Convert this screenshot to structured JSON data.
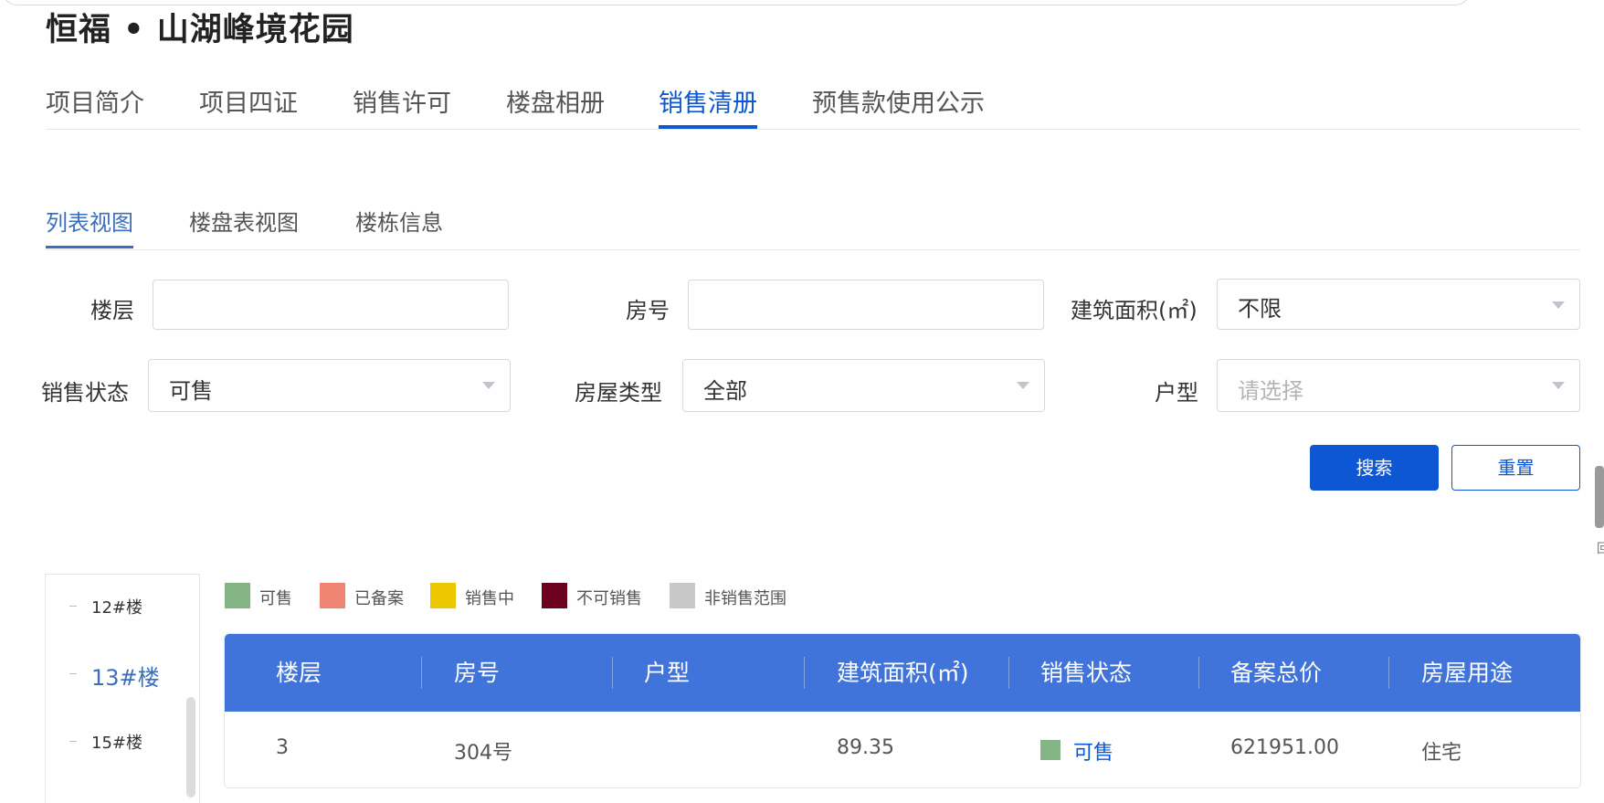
{
  "page": {
    "title": "恒福 • 山湖峰境花园"
  },
  "main_tabs": [
    {
      "label": "项目简介",
      "active": false
    },
    {
      "label": "项目四证",
      "active": false
    },
    {
      "label": "销售许可",
      "active": false
    },
    {
      "label": "楼盘相册",
      "active": false
    },
    {
      "label": "销售清册",
      "active": true
    },
    {
      "label": "预售款使用公示",
      "active": false
    }
  ],
  "sub_tabs": [
    {
      "label": "列表视图",
      "active": true
    },
    {
      "label": "楼盘表视图",
      "active": false
    },
    {
      "label": "楼栋信息",
      "active": false
    }
  ],
  "filters": {
    "floor": {
      "label": "楼层",
      "value": ""
    },
    "room_no": {
      "label": "房号",
      "value": ""
    },
    "area": {
      "label": "建筑面积(㎡)",
      "value": "不限"
    },
    "sale_status": {
      "label": "销售状态",
      "value": "可售"
    },
    "house_type": {
      "label": "房屋类型",
      "value": "全部"
    },
    "layout": {
      "label": "户型",
      "placeholder": "请选择",
      "value": ""
    }
  },
  "buttons": {
    "search": "搜索",
    "reset": "重置"
  },
  "edge_text": "回",
  "buildings": [
    {
      "label": "12#楼",
      "active": false
    },
    {
      "label": "13#楼",
      "active": true
    },
    {
      "label": "15#楼",
      "active": false
    }
  ],
  "legend": [
    {
      "label": "可售",
      "color": "#85b584"
    },
    {
      "label": "已备案",
      "color": "#ee8471"
    },
    {
      "label": "销售中",
      "color": "#edc800"
    },
    {
      "label": "不可销售",
      "color": "#6b001f"
    },
    {
      "label": "非销售范围",
      "color": "#c8c8c8"
    }
  ],
  "colors": {
    "primary": "#0e57d4",
    "table_header": "#4174db"
  },
  "table": {
    "columns": [
      "楼层",
      "房号",
      "户型",
      "建筑面积(㎡)",
      "销售状态",
      "备案总价",
      "房屋用途"
    ],
    "rows": [
      {
        "floor": "3",
        "room": "304号",
        "layout": "",
        "area": "89.35",
        "status": "可售",
        "status_color": "#85b584",
        "price": "621951.00",
        "usage": "住宅"
      }
    ]
  }
}
